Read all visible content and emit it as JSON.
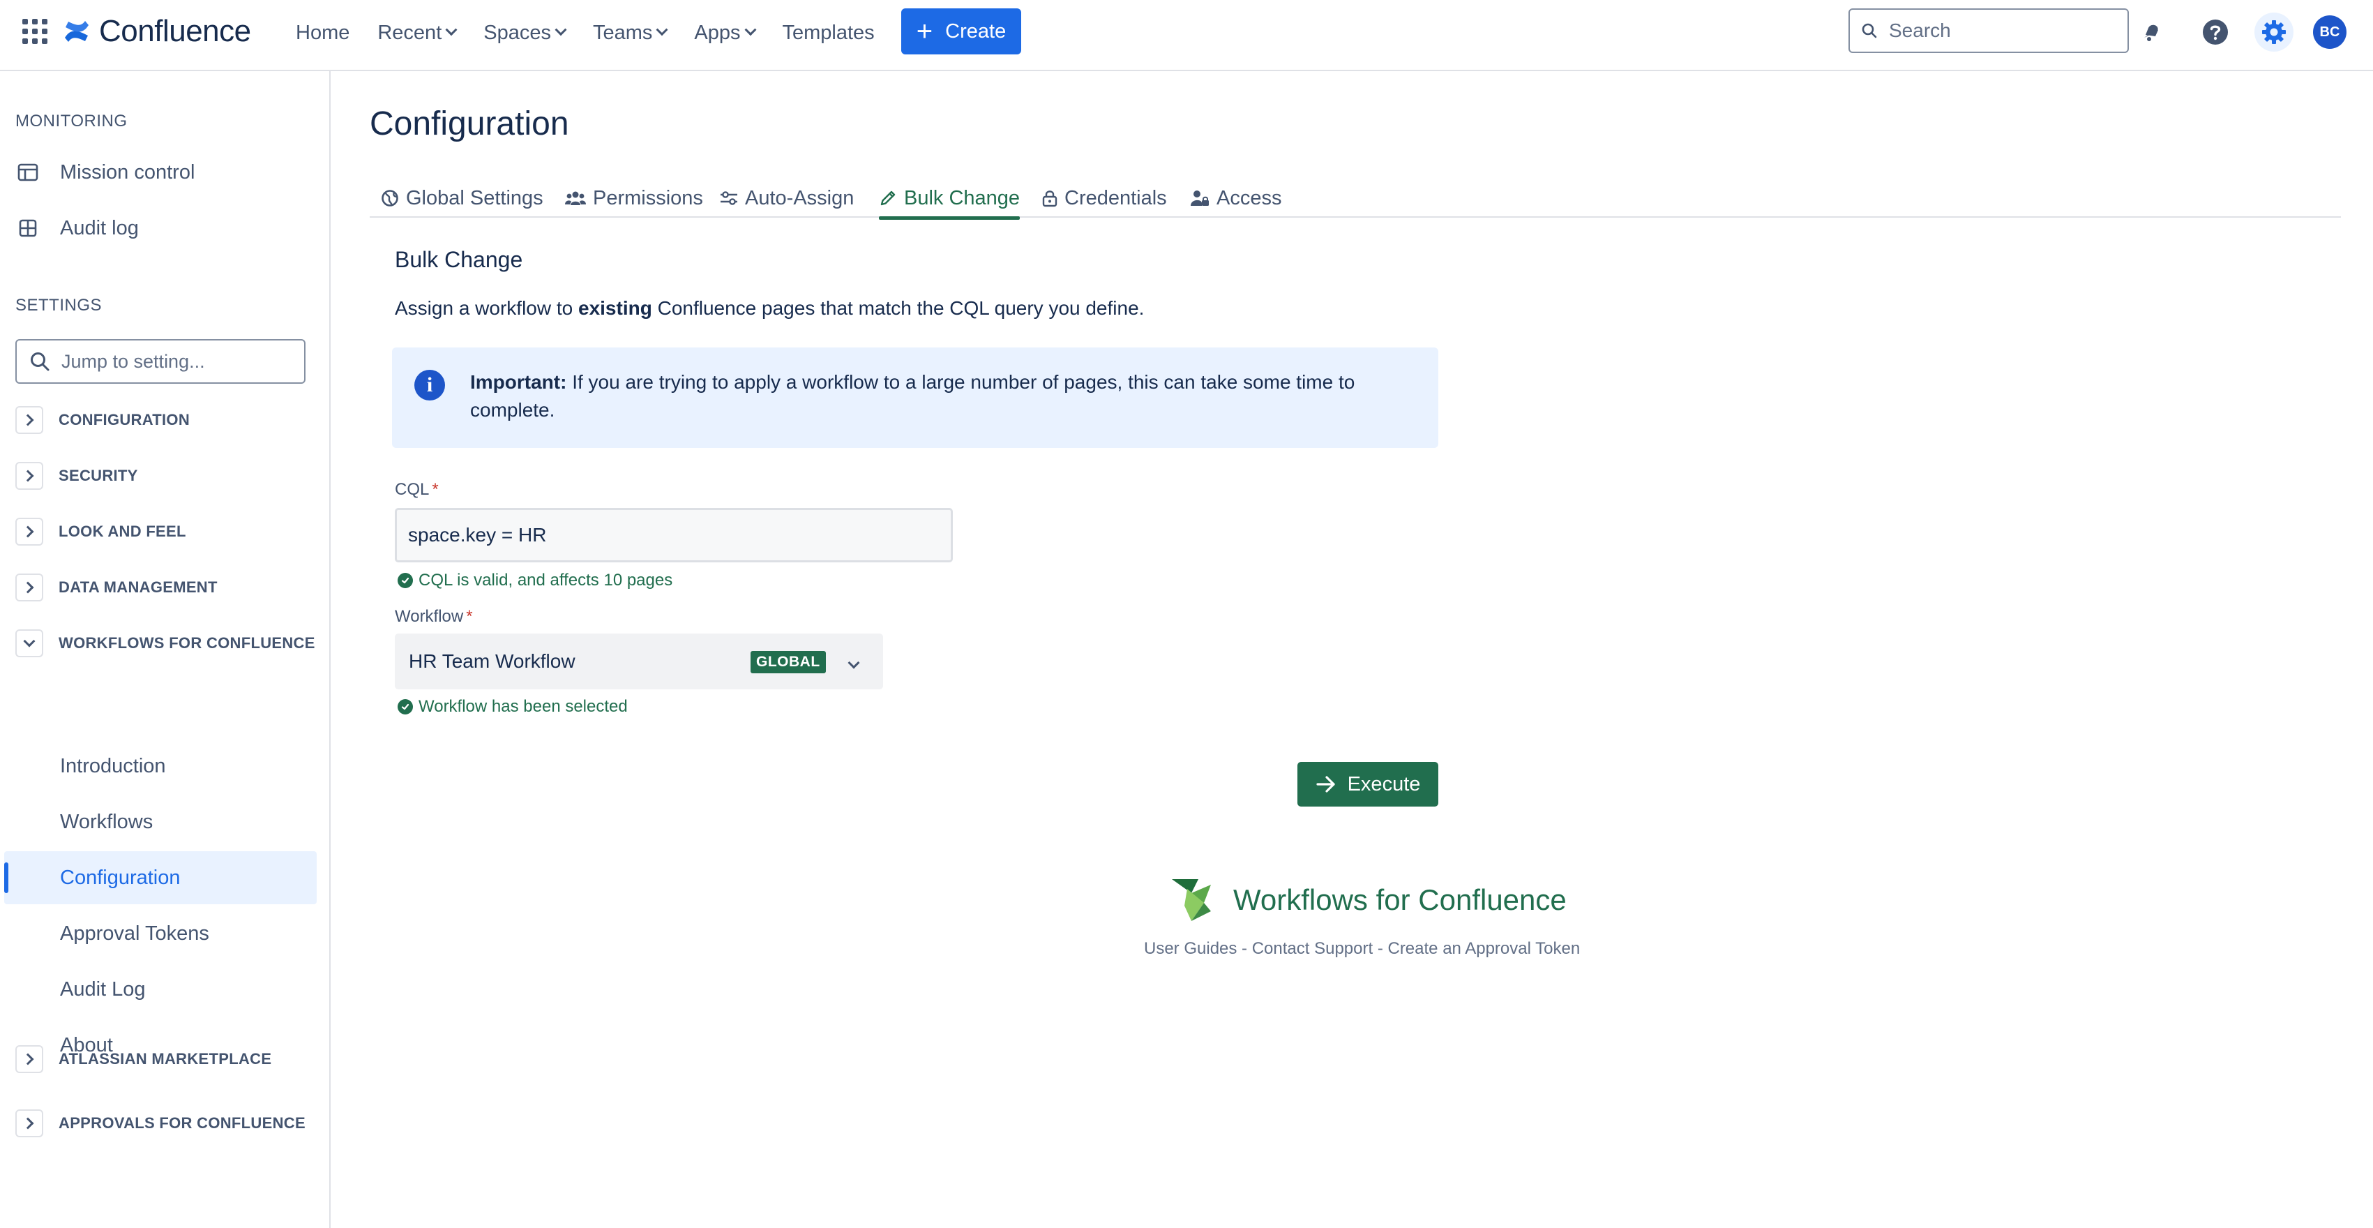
{
  "topnav": {
    "logo_text": "Confluence",
    "links": [
      {
        "label": "Home",
        "has_dropdown": false
      },
      {
        "label": "Recent",
        "has_dropdown": true
      },
      {
        "label": "Spaces",
        "has_dropdown": true
      },
      {
        "label": "Teams",
        "has_dropdown": true
      },
      {
        "label": "Apps",
        "has_dropdown": true
      },
      {
        "label": "Templates",
        "has_dropdown": false
      }
    ],
    "create_label": "Create",
    "search_placeholder": "Search",
    "avatar_initials": "BC",
    "icons": [
      "app-switcher-icon",
      "notifications-icon",
      "help-icon",
      "settings-icon"
    ]
  },
  "sidebar": {
    "monitoring_title": "MONITORING",
    "monitoring_items": [
      {
        "label": "Mission control",
        "icon": "panel-icon"
      },
      {
        "label": "Audit log",
        "icon": "grid-icon"
      }
    ],
    "settings_title": "SETTINGS",
    "search_placeholder": "Jump to setting...",
    "groups_top": [
      {
        "label": "CONFIGURATION",
        "expanded": false
      },
      {
        "label": "SECURITY",
        "expanded": false
      },
      {
        "label": "LOOK AND FEEL",
        "expanded": false
      },
      {
        "label": "DATA MANAGEMENT",
        "expanded": false
      },
      {
        "label": "WORKFLOWS FOR CONFLUENCE",
        "expanded": true
      }
    ],
    "workflow_items": [
      {
        "label": "Introduction"
      },
      {
        "label": "Workflows"
      },
      {
        "label": "Configuration",
        "active": true
      },
      {
        "label": "Approval Tokens"
      },
      {
        "label": "Audit Log"
      },
      {
        "label": "About"
      }
    ],
    "groups_bottom": [
      {
        "label": "ATLASSIAN MARKETPLACE",
        "expanded": false
      },
      {
        "label": "APPROVALS FOR CONFLUENCE",
        "expanded": false
      }
    ]
  },
  "main": {
    "title": "Configuration",
    "tabs": [
      {
        "label": "Global Settings",
        "icon": "globe-icon"
      },
      {
        "label": "Permissions",
        "icon": "people-icon"
      },
      {
        "label": "Auto-Assign",
        "icon": "sliders-icon"
      },
      {
        "label": "Bulk Change",
        "icon": "pencil-icon",
        "active": true
      },
      {
        "label": "Credentials",
        "icon": "lock-icon"
      },
      {
        "label": "Access",
        "icon": "user-lock-icon"
      }
    ],
    "section_title": "Bulk Change",
    "description_pre": "Assign a workflow to ",
    "description_bold": "existing",
    "description_post": " Confluence pages that match the CQL query you define.",
    "info_bold": "Important:",
    "info_text": " If you are trying to apply a workflow to a large number of pages, this can take some time to complete.",
    "cql_label": "CQL",
    "required_mark": "*",
    "cql_value": "space.key = HR",
    "cql_hint": "CQL is valid, and affects 10 pages",
    "workflow_label": "Workflow",
    "workflow_value": "HR Team Workflow",
    "workflow_badge": "GLOBAL",
    "workflow_hint": "Workflow has been selected",
    "execute_label": "Execute",
    "footer_brand": "Workflows for Confluence",
    "footer_links": [
      "User Guides",
      "Contact Support",
      "Create an Approval Token"
    ],
    "footer_separator": " - "
  },
  "colors": {
    "primary_blue": "#1d6ae5",
    "success_green": "#216e4e",
    "info_bg": "#e9f2ff",
    "text_subtle": "#44546f"
  }
}
